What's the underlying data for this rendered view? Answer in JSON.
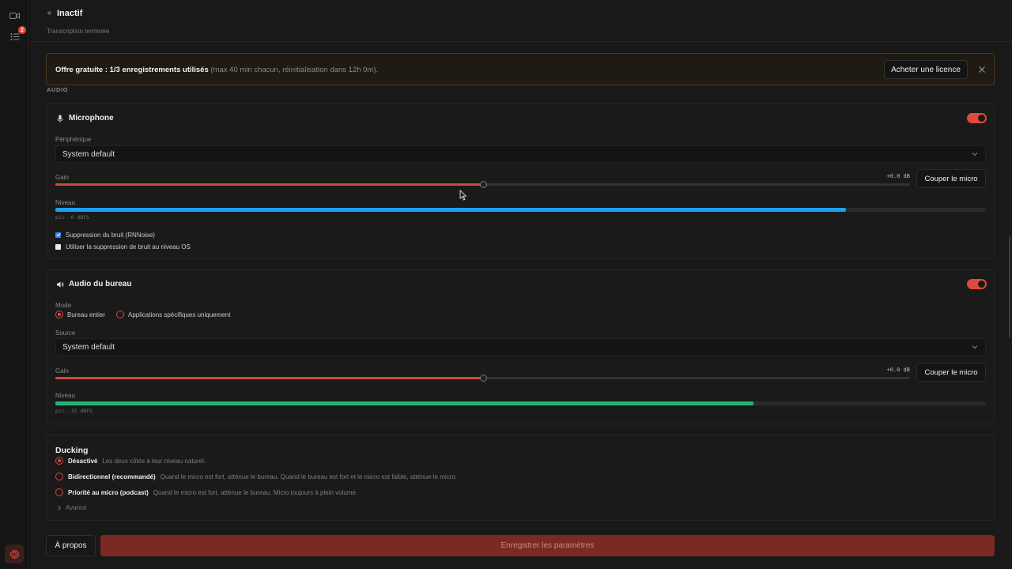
{
  "status": {
    "title": "Inactif",
    "subtitle": "Transcription terminée"
  },
  "rail": {
    "badge_count": "2"
  },
  "banner": {
    "bold_text": "Offre gratuite : 1/3 enregistrements utilisés",
    "muted_text": "(max 40 min chacun, réinitialisation dans 12h 0m).",
    "buy_label": "Acheter une licence"
  },
  "section_audio": "AUDIO",
  "microphone": {
    "title": "Microphone",
    "enabled": true,
    "device_label": "Périphérique",
    "device_value": "System default",
    "gain_label": "Gain",
    "gain_value": "+0.0 dB",
    "gain_fraction": 0.5,
    "mute_label": "Couper le micro",
    "level_label": "Niveau",
    "level_fraction": 0.85,
    "level_color": "#1ea0f0",
    "peak": "pic -0 dBFS",
    "options": [
      {
        "label": "Suppression du bruit (RNNoise)",
        "checked": true
      },
      {
        "label": "Utiliser la suppression de bruit au niveau OS",
        "checked": false
      }
    ]
  },
  "desktop_audio": {
    "title": "Audio du bureau",
    "enabled": true,
    "mode_label": "Mode",
    "modes": [
      {
        "label": "Bureau entier",
        "selected": true
      },
      {
        "label": "Applications spécifiques uniquement",
        "selected": false
      }
    ],
    "source_label": "Source",
    "source_value": "System default",
    "gain_label": "Gain",
    "gain_value": "+0.0 dB",
    "gain_fraction": 0.5,
    "mute_label": "Couper le micro",
    "level_label": "Niveau",
    "level_fraction": 0.75,
    "level_color": "#22b57a",
    "peak": "pic -15 dBFS"
  },
  "ducking": {
    "title": "Ducking",
    "options": [
      {
        "name": "Désactivé",
        "desc": "Les deux côtés à leur niveau naturel.",
        "selected": true
      },
      {
        "name": "Bidirectionnel (recommandé)",
        "desc": "Quand le micro est fort, atténue le bureau. Quand le bureau est fort et le micro est faible, atténue le micro.",
        "selected": false
      },
      {
        "name": "Priorité au micro (podcast)",
        "desc": "Quand le micro est fort, atténue le bureau. Micro toujours à plein volume.",
        "selected": false
      }
    ],
    "advanced_label": "Avancé"
  },
  "footer": {
    "about_label": "À propos",
    "save_label": "Enregistrer les paramètres"
  },
  "colors": {
    "accent": "#e04a3c",
    "save_bg": "#7a2a22"
  },
  "icons": {
    "camera": "camera-icon",
    "list": "list-icon",
    "gear": "gear-icon",
    "mic": "mic-icon",
    "speaker": "speaker-icon",
    "close": "close-icon",
    "chevron": "chevron-down-icon"
  }
}
